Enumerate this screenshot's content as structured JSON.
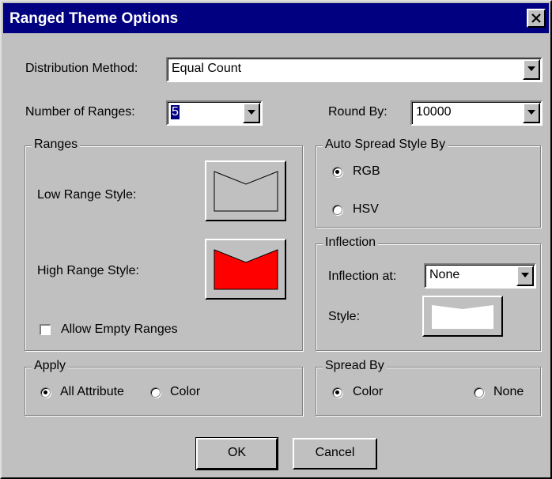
{
  "window": {
    "title": "Ranged Theme Options"
  },
  "distribution": {
    "label": "Distribution Method:",
    "value": "Equal Count"
  },
  "ranges_count": {
    "label": "Number of Ranges:",
    "value": "5"
  },
  "round_by": {
    "label": "Round By:",
    "value": "10000"
  },
  "ranges_group": {
    "title": "Ranges",
    "low_label": "Low Range Style:",
    "high_label": "High Range Style:",
    "allow_empty_label": "Allow Empty Ranges",
    "allow_empty_checked": false,
    "low_color": "#c0c0c0",
    "high_color": "#ff0000"
  },
  "auto_spread": {
    "title": "Auto Spread Style By",
    "options": [
      "RGB",
      "HSV"
    ],
    "selected": "RGB"
  },
  "inflection": {
    "title": "Inflection",
    "at_label": "Inflection at:",
    "at_value": "None",
    "style_label": "Style:",
    "style_color": "#ffffff"
  },
  "apply": {
    "title": "Apply",
    "options": [
      "All Attribute",
      "Color"
    ],
    "selected": "All Attribute"
  },
  "spread_by": {
    "title": "Spread By",
    "options": [
      "Color",
      "None"
    ],
    "selected": "Color"
  },
  "buttons": {
    "ok": "OK",
    "cancel": "Cancel"
  }
}
